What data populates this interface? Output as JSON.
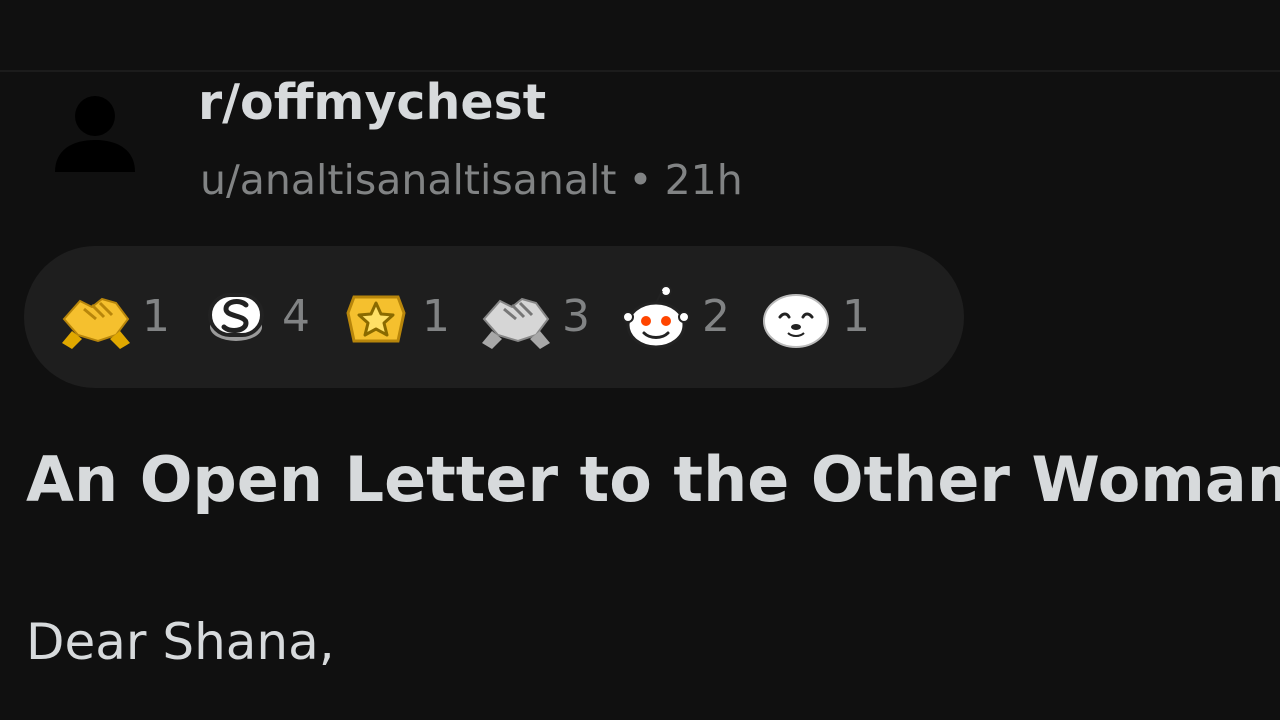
{
  "post": {
    "subreddit": "r/offmychest",
    "author": "u/analtisanaltisanalt",
    "separator": "•",
    "age": "21h",
    "title": "An Open Letter to the Other Woman",
    "body_first_line": "Dear Shana,"
  },
  "awards": [
    {
      "icon": "gold-handshake-award-icon",
      "count": "1"
    },
    {
      "icon": "silver-s-award-icon",
      "count": "4"
    },
    {
      "icon": "gold-star-award-icon",
      "count": "1"
    },
    {
      "icon": "silver-handshake-award-icon",
      "count": "3"
    },
    {
      "icon": "snoo-face-award-icon",
      "count": "2"
    },
    {
      "icon": "seal-award-icon",
      "count": "1"
    }
  ],
  "colors": {
    "background": "#101010",
    "award_bar": "#1e1e1e",
    "primary_text": "#d7dadc",
    "secondary_text": "#818384",
    "gold": "#f5c02e",
    "silver": "#c8c8c8"
  }
}
